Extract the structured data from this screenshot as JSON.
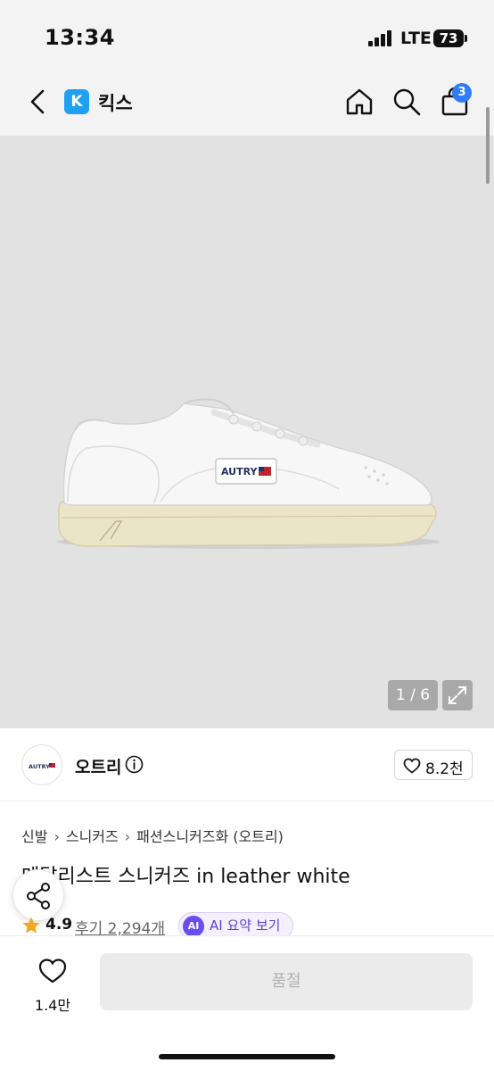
{
  "status_bar": {
    "time": "13:34",
    "network": "LTE",
    "battery": "73"
  },
  "header": {
    "brand_logo_letter": "K",
    "brand_name": "킥스",
    "cart_count": "3"
  },
  "gallery": {
    "page_indicator": "1 / 6",
    "logo_text": "AUTRY"
  },
  "brand": {
    "avatar_text": "AUTRY",
    "name": "오트리",
    "like_count": "8.2천"
  },
  "breadcrumb": [
    "신발",
    "스니커즈",
    "패션스니커즈화 (오트리)"
  ],
  "product": {
    "title": "메달리스트 스니커즈 in leather white"
  },
  "rating": {
    "value": "4.9",
    "review_label": "후기 2,294개",
    "ai_badge": "AI",
    "ai_summary_label": "AI 요약 보기"
  },
  "bottom_bar": {
    "wish_count": "1.4만",
    "soldout_label": "품절"
  },
  "colors": {
    "accent_blue": "#2f7cf6",
    "kicks_blue": "#1ea1f2",
    "ai_purple": "#6b4ef0",
    "star": "#f5a623"
  }
}
